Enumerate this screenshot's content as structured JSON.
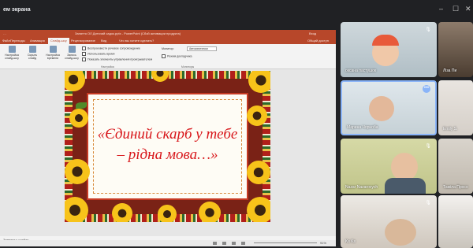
{
  "window": {
    "title": "ем экрана",
    "controls": [
      "–",
      "☐",
      "✕"
    ]
  },
  "powerpoint": {
    "title_left": "…",
    "title_center": "Заняття ОЛ Дитячий садок.pptx - PowerPoint (Сбой активации продукта)",
    "title_right": "Вход",
    "tabs": [
      "Файл",
      "Переходы",
      "Анимация",
      "Слайд-шоу",
      "Рецензирование",
      "Вид",
      "Что вы хотите сделать?",
      "Общий доступ"
    ],
    "active_tab_index": 3,
    "ribbon_buttons": [
      "Настройка слайд-шоу",
      "Скрыть слайд",
      "Настройка времени",
      "Запись слайд-шоу"
    ],
    "ribbon_checks": [
      "Воспроизвести речевое сопровождение",
      "Использовать время",
      "Показать элементы управления проигрывателем"
    ],
    "monitor_label": "Монитор:",
    "monitor_value": "Автоматически",
    "presenter_check": "Режим докладчика",
    "group_labels": [
      "Настройка",
      "Мониторы"
    ],
    "notes_placeholder": "Заметки к слайду",
    "zoom": "91%"
  },
  "slide": {
    "line1": "«Єдиний скарб у тебе",
    "line2": "– рідна мова…»"
  },
  "participants": [
    {
      "name": "оксана пастушок",
      "muted": true
    },
    {
      "name": "Ліза Пи",
      "muted": false
    },
    {
      "name": "Марина Чорноба",
      "muted": false,
      "speaking": true
    },
    {
      "name": "Emily S.",
      "muted": false
    },
    {
      "name": "Nazar Nazarovych",
      "muted": true
    },
    {
      "name": "Таміла Просо",
      "muted": false
    },
    {
      "name": "Ks Ks",
      "muted": true
    },
    {
      "name": "",
      "muted": false
    }
  ],
  "colors": {
    "meet_bg": "#202124",
    "ppt_accent": "#b7472a",
    "slide_text": "#d8161a",
    "speaking_outline": "#8ab4f8"
  }
}
